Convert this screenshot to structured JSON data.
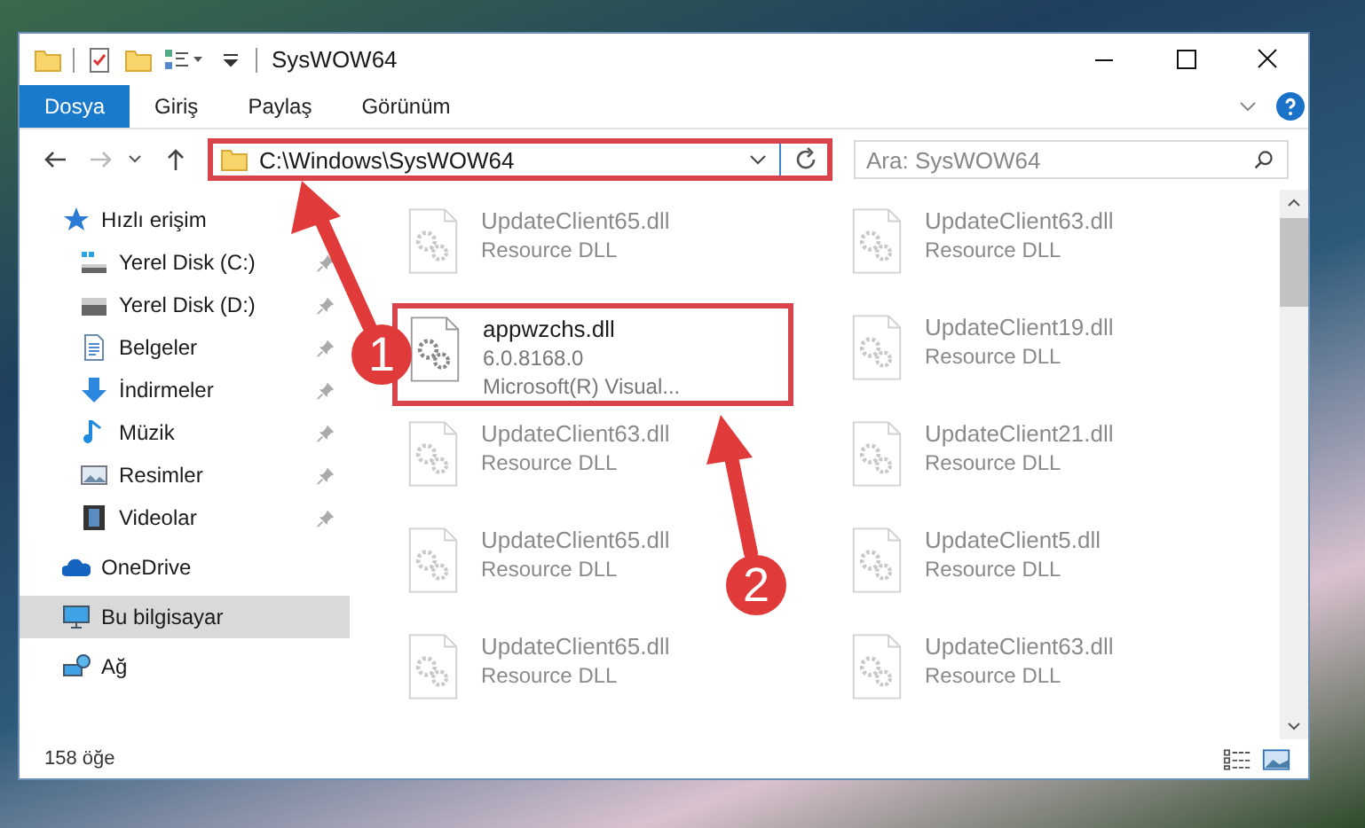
{
  "window": {
    "title": "SysWOW64"
  },
  "ribbon_tabs": [
    {
      "label": "Dosya",
      "selected": true
    },
    {
      "label": "Giriş",
      "selected": false
    },
    {
      "label": "Paylaş",
      "selected": false
    },
    {
      "label": "Görünüm",
      "selected": false
    }
  ],
  "address_bar": {
    "value": "C:\\Windows\\SysWOW64",
    "highlighted": true
  },
  "search": {
    "placeholder": "Ara: SysWOW64"
  },
  "sidebar": {
    "items": [
      {
        "label": "Hızlı erişim",
        "kind": "section",
        "pinned": false,
        "selected": false
      },
      {
        "label": "Yerel Disk (C:)",
        "kind": "item",
        "pinned": true,
        "selected": false
      },
      {
        "label": "Yerel Disk (D:)",
        "kind": "item",
        "pinned": true,
        "selected": false
      },
      {
        "label": "Belgeler",
        "kind": "item",
        "pinned": true,
        "selected": false
      },
      {
        "label": "İndirmeler",
        "kind": "item",
        "pinned": true,
        "selected": false
      },
      {
        "label": "Müzik",
        "kind": "item",
        "pinned": true,
        "selected": false
      },
      {
        "label": "Resimler",
        "kind": "item",
        "pinned": true,
        "selected": false
      },
      {
        "label": "Videolar",
        "kind": "item",
        "pinned": true,
        "selected": false
      },
      {
        "label": "OneDrive",
        "kind": "section",
        "pinned": false,
        "selected": false
      },
      {
        "label": "Bu bilgisayar",
        "kind": "section",
        "pinned": false,
        "selected": true
      },
      {
        "label": "Ağ",
        "kind": "section",
        "pinned": false,
        "selected": false
      }
    ]
  },
  "files": [
    {
      "name": "UpdateClient65.dll",
      "details": [
        "Resource DLL"
      ],
      "dimmed": true,
      "highlighted": false
    },
    {
      "name": "UpdateClient63.dll",
      "details": [
        "Resource DLL"
      ],
      "dimmed": true,
      "highlighted": false
    },
    {
      "name": "appwzchs.dll",
      "details": [
        "6.0.8168.0",
        "Microsoft(R) Visual..."
      ],
      "dimmed": false,
      "highlighted": true
    },
    {
      "name": "UpdateClient19.dll",
      "details": [
        "Resource DLL"
      ],
      "dimmed": true,
      "highlighted": false
    },
    {
      "name": "UpdateClient63.dll",
      "details": [
        "Resource DLL"
      ],
      "dimmed": true,
      "highlighted": false
    },
    {
      "name": "UpdateClient21.dll",
      "details": [
        "Resource DLL"
      ],
      "dimmed": true,
      "highlighted": false
    },
    {
      "name": "UpdateClient65.dll",
      "details": [
        "Resource DLL"
      ],
      "dimmed": true,
      "highlighted": false
    },
    {
      "name": "UpdateClient5.dll",
      "details": [
        "Resource DLL"
      ],
      "dimmed": true,
      "highlighted": false
    },
    {
      "name": "UpdateClient65.dll",
      "details": [
        "Resource DLL"
      ],
      "dimmed": true,
      "highlighted": false
    },
    {
      "name": "UpdateClient63.dll",
      "details": [
        "Resource DLL"
      ],
      "dimmed": true,
      "highlighted": false
    }
  ],
  "status_bar": {
    "item_count": "158 öğe"
  },
  "annotations": [
    {
      "number": "1"
    },
    {
      "number": "2"
    }
  ]
}
